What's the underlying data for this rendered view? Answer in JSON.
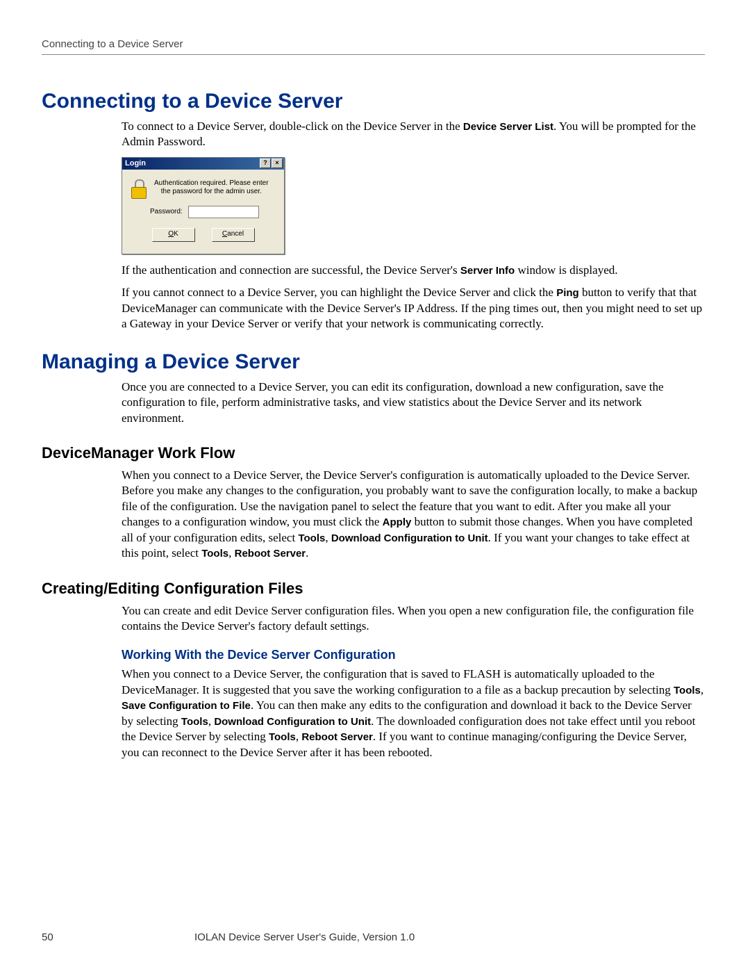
{
  "header": {
    "running_head": "Connecting to a Device Server"
  },
  "h1_connect": "Connecting to a Device Server",
  "p_connect_1a": "To connect to a Device Server, double-click on the Device Server in the ",
  "p_connect_1b_bold": "Device Server List",
  "p_connect_1c": ". You will be prompted for the Admin Password.",
  "login_dialog": {
    "title": "Login",
    "help_glyph": "?",
    "close_glyph": "×",
    "message_l1": "Authentication required. Please enter",
    "message_l2": "the password for the admin user.",
    "password_label": "Password:",
    "ok_prefix": "O",
    "ok_rest": "K",
    "cancel_prefix": "C",
    "cancel_rest": "ancel"
  },
  "p_connect_2a": "If the authentication and connection are successful, the Device Server's ",
  "p_connect_2b_bold": "Server Info",
  "p_connect_2c": " window is displayed.",
  "p_connect_3a": "If you cannot connect to a Device Server, you can highlight the Device Server and click the ",
  "p_connect_3b_bold": "Ping",
  "p_connect_3c": " button to verify that that DeviceManager can communicate with the Device Server's IP Address. If the ping times out, then you might need to set up a Gateway in your Device Server or verify that your network is communicating correctly.",
  "h1_manage": "Managing a Device Server",
  "p_manage_1": "Once you are connected to a Device Server, you can edit its configuration, download a new configuration, save the configuration to file, perform administrative tasks, and view statistics about the Device Server and its network environment.",
  "h2_workflow": "DeviceManager Work Flow",
  "p_wf_1a": "When you connect to a Device Server, the Device Server's configuration is automatically uploaded to the Device Server. Before you make any changes to the configuration, you probably want to save the configuration locally, to make a backup file of the configuration. Use the navigation panel to select the feature that you want to edit. After you make all your changes to a configuration window, you must click the ",
  "p_wf_1b_bold": "Apply",
  "p_wf_1c": " button to submit those changes. When you have completed all of your configuration edits, select ",
  "p_wf_1d_bold": "Tools",
  "p_wf_1e": ", ",
  "p_wf_1f_bold": "Download Configuration to Unit",
  "p_wf_1g": ". If you want your changes to take effect at this point, select ",
  "p_wf_1h_bold": "Tools",
  "p_wf_1i": ", ",
  "p_wf_1j_bold": "Reboot Server",
  "p_wf_1k": ".",
  "h2_config": "Creating/Editing Configuration Files",
  "p_cfg_1": "You can create and edit Device Server configuration files. When you open a new configuration file, the configuration file contains the Device Server's factory default settings.",
  "h3_working": "Working With the Device Server Configuration",
  "p_work_1a": "When you connect to a Device Server, the configuration that is saved to FLASH is automatically uploaded to the DeviceManager. It is suggested that you save the working configuration to a file as a backup precaution by selecting ",
  "p_work_1b_bold": "Tools",
  "p_work_1c": ", ",
  "p_work_1d_bold": "Save Configuration to File",
  "p_work_1e": ". You can then make any edits to the configuration and download it back to the Device Server by selecting ",
  "p_work_1f_bold": "Tools",
  "p_work_1g": ", ",
  "p_work_1h_bold": "Download Configuration to Unit",
  "p_work_1i": ". The downloaded configuration does not take effect until you reboot the Device Server by selecting ",
  "p_work_1j_bold": "Tools",
  "p_work_1k": ", ",
  "p_work_1l_bold": "Reboot Server",
  "p_work_1m": ". If you want to continue managing/configuring the Device Server, you can reconnect to the Device Server after it has been rebooted.",
  "footer": {
    "page_number": "50",
    "text": "IOLAN Device Server User's Guide, Version 1.0"
  }
}
